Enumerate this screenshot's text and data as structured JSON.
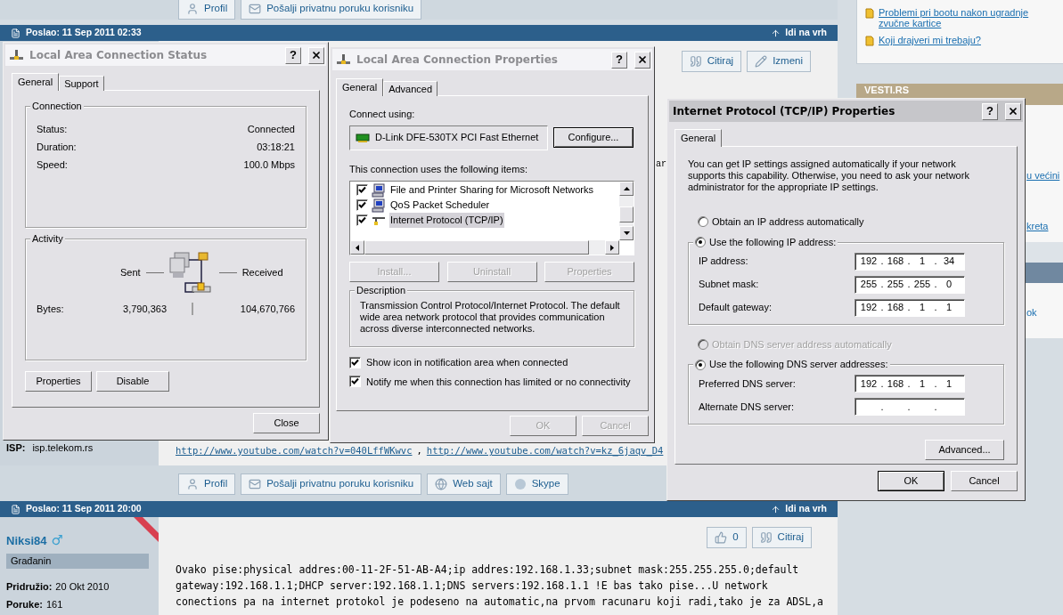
{
  "forum": {
    "top_buttons": [
      {
        "kind": "profile",
        "label": "Profil"
      },
      {
        "kind": "message",
        "label": "Pošalji privatnu poruku korisniku"
      }
    ],
    "post1": {
      "posted": "Poslao: 11 Sep 2011 02:33",
      "top_link": "Idi na vrh",
      "actions": [
        {
          "kind": "quote",
          "label": "Citiraj"
        },
        {
          "kind": "edit",
          "label": "Izmeni"
        }
      ],
      "text_fragment": "ar",
      "isp_label": "ISP:",
      "isp_value": "isp.telekom.rs",
      "links": [
        "http://www.youtube.com/watch?v=040LffWKwvc",
        "http://www.youtube.com/watch?v=kz_6jaqv_D4"
      ],
      "link_separator": ","
    },
    "bottom_buttons": [
      {
        "kind": "profile",
        "label": "Profil"
      },
      {
        "kind": "message",
        "label": "Pošalji privatnu poruku korisniku"
      },
      {
        "kind": "web",
        "label": "Web sajt"
      },
      {
        "kind": "skype",
        "label": "Skype"
      }
    ],
    "post2": {
      "posted": "Poslao: 11 Sep 2011 20:00",
      "top_link": "Idi na vrh",
      "author": "Niksi84",
      "gender": "♂",
      "rank": "Građanin",
      "joined_label": "Pridružio:",
      "joined": "20 Okt 2010",
      "posts_label": "Poruke:",
      "posts": "161",
      "actions": [
        {
          "kind": "like",
          "label": "0"
        },
        {
          "kind": "quote",
          "label": "Citiraj"
        }
      ],
      "lines": [
        "Ovako pise:physical addres:00-11-2F-51-AB-A4;ip addres:192.168.1.33;subnet mask:255.255.255.0;default",
        "gateway:192.168.1.1;DHCP server:192.168.1.1;DNS servers:192.168.1.1 !E bas tako pise...U network",
        "conections pa na internet protokol je podeseno na automatic,na prvom racunaru koji radi,tako je za ADSL,a"
      ]
    }
  },
  "sidebar": {
    "topics": [
      "Problemi pri bootu nakon ugradnje zvučne kartice",
      "Koji drajveri mi trebaju?"
    ],
    "news_title": "VESTI.RS",
    "fragments": [
      "u većini",
      "kreta",
      "ok"
    ]
  },
  "status_dialog": {
    "title": "Local Area Connection Status",
    "active": false,
    "help": "?",
    "tabs": [
      {
        "label": "General",
        "selected": true
      },
      {
        "label": "Support",
        "selected": false
      }
    ],
    "connection": {
      "title": "Connection",
      "rows": [
        {
          "label": "Status:",
          "value": "Connected"
        },
        {
          "label": "Duration:",
          "value": "03:18:21"
        },
        {
          "label": "Speed:",
          "value": "100.0 Mbps"
        }
      ]
    },
    "activity": {
      "title": "Activity",
      "sent": "Sent",
      "received": "Received",
      "bytes_label": "Bytes:",
      "sent_bytes": "3,790,363",
      "received_bytes": "104,670,766"
    },
    "buttons": [
      {
        "label": "Properties",
        "disabled": false
      },
      {
        "label": "Disable",
        "disabled": false
      }
    ],
    "close": "Close"
  },
  "properties_dialog": {
    "title": "Local Area Connection Properties",
    "active": false,
    "help": "?",
    "tabs": [
      {
        "label": "General",
        "selected": true
      },
      {
        "label": "Advanced",
        "selected": false
      }
    ],
    "connect_using": "Connect using:",
    "adapter": "D-Link DFE-530TX PCI Fast Ethernet",
    "configure": "Configure...",
    "items_label": "This connection uses the following items:",
    "items": [
      {
        "kind": "service",
        "label": "File and Printer Sharing for Microsoft Networks",
        "checked": true,
        "selected": false
      },
      {
        "kind": "service",
        "label": "QoS Packet Scheduler",
        "checked": true,
        "selected": false
      },
      {
        "kind": "protocol",
        "label": "Internet Protocol (TCP/IP)",
        "checked": true,
        "selected": true
      }
    ],
    "buttons": [
      {
        "label": "Install...",
        "disabled": true
      },
      {
        "label": "Uninstall",
        "disabled": true
      },
      {
        "label": "Properties",
        "disabled": true
      }
    ],
    "description_title": "Description",
    "description": "Transmission Control Protocol/Internet Protocol. The default wide area network protocol that provides communication across diverse interconnected networks.",
    "options": [
      {
        "label": "Show icon in notification area when connected",
        "checked": true
      },
      {
        "label": "Notify me when this connection has limited or no connectivity",
        "checked": true
      }
    ],
    "footer": [
      {
        "label": "OK",
        "disabled": true
      },
      {
        "label": "Cancel",
        "disabled": true
      }
    ]
  },
  "tcpip_dialog": {
    "title": "Internet Protocol (TCP/IP) Properties",
    "active": true,
    "help": "?",
    "tabs": [
      {
        "label": "General",
        "selected": true
      }
    ],
    "intro": "You can get IP settings assigned automatically if your network supports this capability. Otherwise, you need to ask your network administrator for the appropriate IP settings.",
    "separator": ".",
    "ip_modes": [
      {
        "label": "Obtain an IP address automatically",
        "selected": false,
        "disabled": false
      },
      {
        "label": "Use the following IP address:",
        "selected": true,
        "disabled": false
      }
    ],
    "ip_fields": [
      {
        "label": "IP address:",
        "octets": [
          "192",
          "168",
          "1",
          "34"
        ]
      },
      {
        "label": "Subnet mask:",
        "octets": [
          "255",
          "255",
          "255",
          "0"
        ]
      },
      {
        "label": "Default gateway:",
        "octets": [
          "192",
          "168",
          "1",
          "1"
        ]
      }
    ],
    "dns_modes": [
      {
        "label": "Obtain DNS server address automatically",
        "selected": false,
        "disabled": true
      },
      {
        "label": "Use the following DNS server addresses:",
        "selected": true,
        "disabled": false
      }
    ],
    "dns_fields": [
      {
        "label": "Preferred DNS server:",
        "octets": [
          "192",
          "168",
          "1",
          "1"
        ]
      },
      {
        "label": "Alternate DNS server:"
      }
    ],
    "advanced": "Advanced...",
    "footer": [
      {
        "label": "OK",
        "default": true
      },
      {
        "label": "Cancel",
        "default": false
      }
    ]
  }
}
